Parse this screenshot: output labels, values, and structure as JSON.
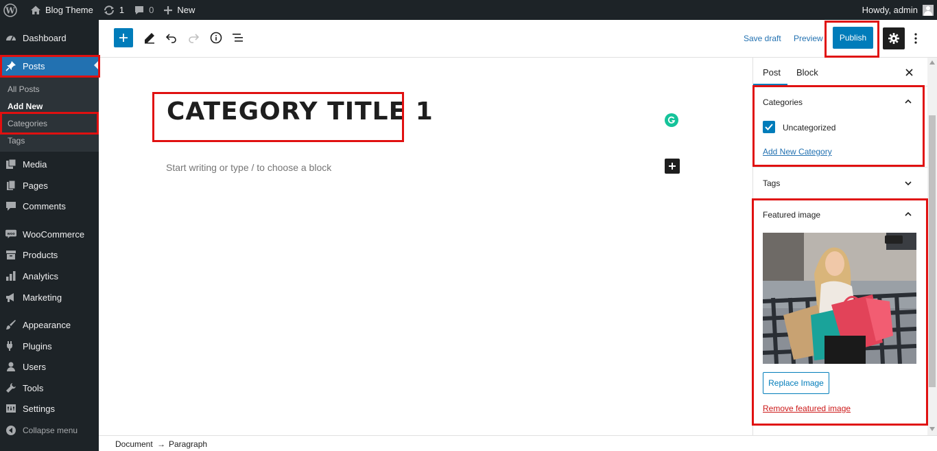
{
  "admin_bar": {
    "site_name": "Blog Theme",
    "updates_count": "1",
    "comments_count": "0",
    "new_label": "New",
    "greeting": "Howdy, admin"
  },
  "sidebar": {
    "dashboard": "Dashboard",
    "posts": "Posts",
    "submenu": [
      "All Posts",
      "Add New",
      "Categories",
      "Tags"
    ],
    "media": "Media",
    "pages": "Pages",
    "comments": "Comments",
    "woocommerce": "WooCommerce",
    "products": "Products",
    "analytics": "Analytics",
    "marketing": "Marketing",
    "appearance": "Appearance",
    "plugins": "Plugins",
    "users": "Users",
    "tools": "Tools",
    "settings": "Settings",
    "collapse": "Collapse menu"
  },
  "header": {
    "save_draft": "Save draft",
    "preview": "Preview",
    "publish": "Publish"
  },
  "editor": {
    "title": "CATEGORY TITLE 1",
    "placeholder": "Start writing or type / to choose a block"
  },
  "settings_panel": {
    "tab_post": "Post",
    "tab_block": "Block",
    "categories_title": "Categories",
    "category_option": "Uncategorized",
    "category_checked": true,
    "add_new_category": "Add New Category",
    "tags_title": "Tags",
    "featured_title": "Featured image",
    "replace_image": "Replace Image",
    "remove_image": "Remove featured image"
  },
  "footer": {
    "crumb_1": "Document",
    "arrow": "→",
    "crumb_2": "Paragraph"
  },
  "colors": {
    "admin_dark": "#1d2327",
    "accent": "#007cba",
    "highlight": "#e01010"
  }
}
